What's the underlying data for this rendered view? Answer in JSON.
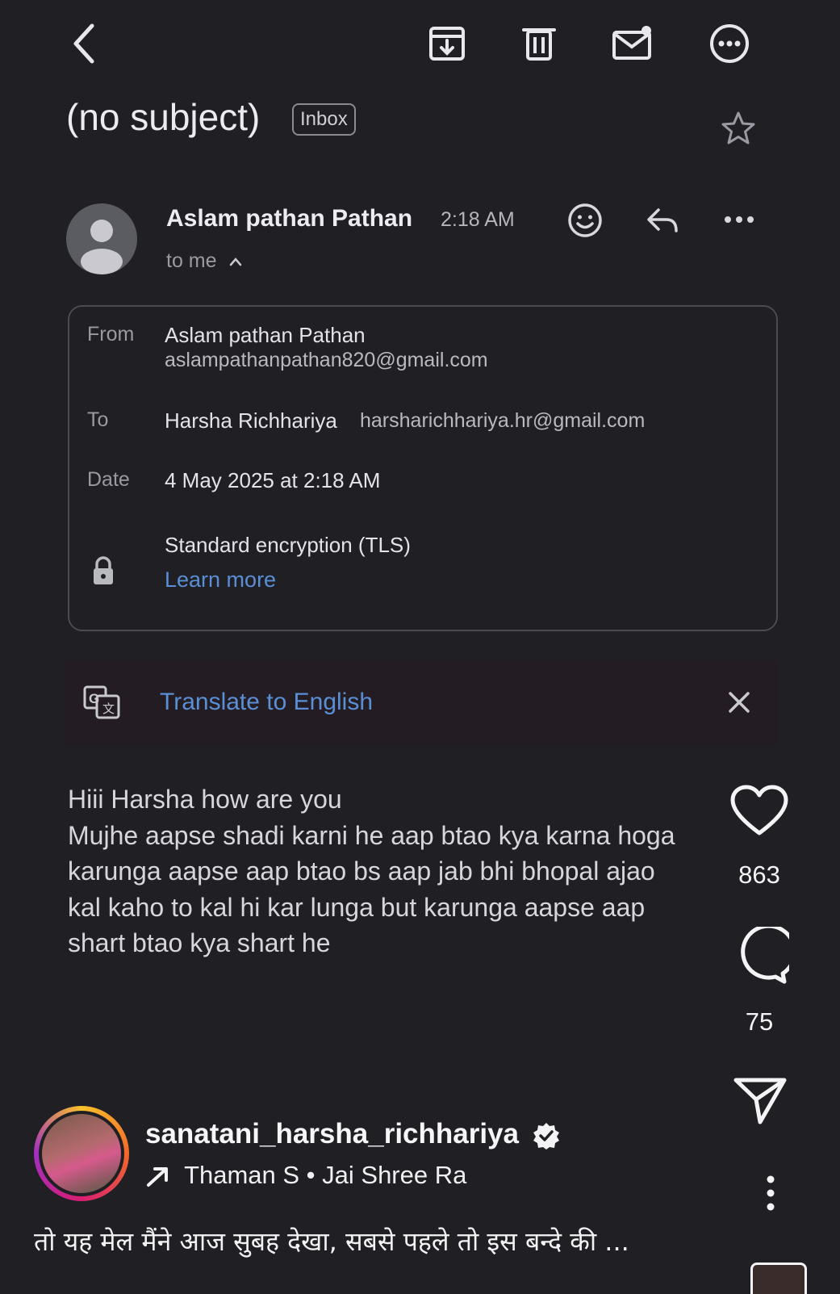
{
  "toolbar": {
    "back_icon": "chevron-left-icon",
    "archive_icon": "archive-icon",
    "delete_icon": "trash-icon",
    "unread_icon": "mark-unread-icon",
    "more_icon": "more-circle-icon"
  },
  "email": {
    "subject": "(no subject)",
    "label": "Inbox",
    "sender_name": "Aslam pathan Pathan",
    "time": "2:18 AM",
    "to_line": "to me",
    "details": {
      "from_label": "From",
      "from_name": "Aslam pathan Pathan",
      "from_email": "aslampathanpathan820@gmail.com",
      "to_label": "To",
      "to_name": "Harsha Richhariya",
      "to_email": "harsharichhariya.hr@gmail.com",
      "date_label": "Date",
      "date_value": "4 May 2025 at 2:18 AM",
      "encryption": "Standard encryption (TLS)",
      "learn_more": "Learn more"
    },
    "translate": {
      "label": "Translate to English"
    },
    "body_lines": [
      "Hiii Harsha  how are you",
      "Mujhe aapse shadi karni he aap btao kya karna hoga",
      "karunga aapse aap btao bs aap jab bhi bhopal ajao",
      "kal kaho to kal hi kar lunga  but karunga aapse aap",
      "shart btao kya shart he"
    ]
  },
  "instagram": {
    "likes": "863",
    "comments": "75",
    "username": "sanatani_harsha_richhariya",
    "music": "Thaman S • Jai Shree Ra",
    "caption": "तो यह मेल मैंने आज सुबह देखा, सबसे पहले तो इस बन्दे की ..."
  },
  "colors": {
    "background": "#1f1f24",
    "link": "#5a8fd6",
    "text": "#e6e6ea"
  }
}
